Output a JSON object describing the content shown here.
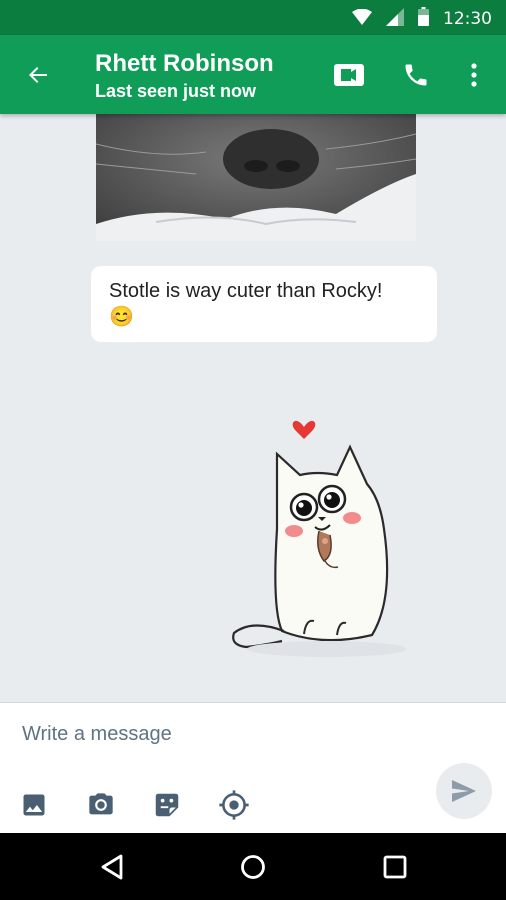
{
  "status_bar": {
    "time": "12:30",
    "icons": [
      "wifi-icon",
      "cell-signal-icon",
      "battery-icon"
    ]
  },
  "header": {
    "title": "Rhett Robinson",
    "subtitle": "Last seen just now",
    "actions": [
      "back-arrow-icon",
      "video-call-icon",
      "phone-icon",
      "more-vert-icon"
    ],
    "color": "#0f9d58",
    "status_color": "#0b7d3e"
  },
  "messages": [
    {
      "type": "photo",
      "image": "cat-nose-photo"
    },
    {
      "type": "text",
      "text": "Stotle is way cuter than Rocky!",
      "emoji": "😊"
    },
    {
      "type": "sticker",
      "image": "white-cat-with-mouse-sticker"
    }
  ],
  "composer": {
    "placeholder": "Write a message",
    "value": "",
    "tools": [
      "gallery-icon",
      "camera-icon",
      "sticker-icon",
      "location-icon"
    ],
    "send": "send-icon"
  },
  "nav": [
    "back-triangle-icon",
    "home-circle-icon",
    "recents-square-icon"
  ]
}
